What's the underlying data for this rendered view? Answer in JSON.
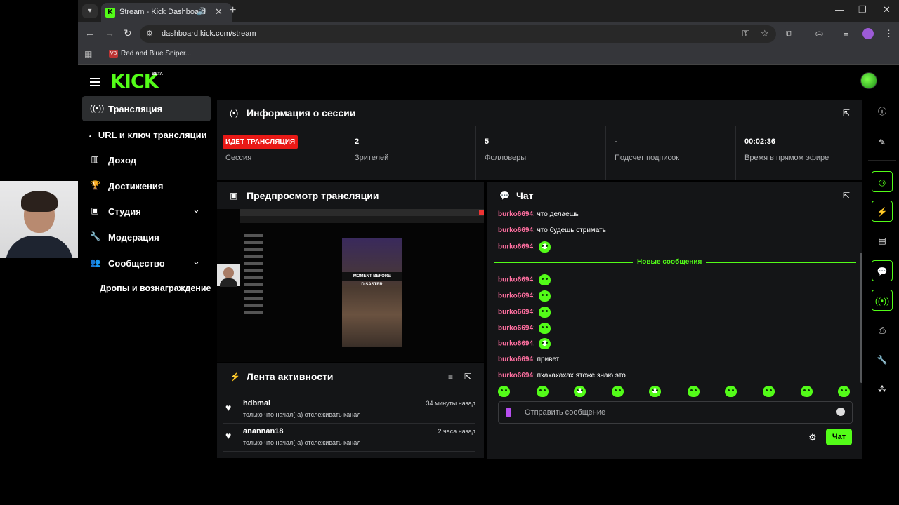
{
  "browser": {
    "tab_title": "Stream - Kick Dashboard",
    "url": "dashboard.kick.com/stream",
    "bookmark_label": "Red and Blue Sniper..."
  },
  "app": {
    "logo_text": "KICK",
    "beta_label": "BETA"
  },
  "sidebar": {
    "items": [
      {
        "label": "Трансляция",
        "icon": "broadcast-icon"
      },
      {
        "label": "URL и ключ трансляции",
        "icon": "dot-icon"
      },
      {
        "label": "Доход",
        "icon": "chart-icon"
      },
      {
        "label": "Достижения",
        "icon": "trophy-icon"
      },
      {
        "label": "Студия",
        "icon": "studio-icon"
      },
      {
        "label": "Модерация",
        "icon": "wrench-icon"
      },
      {
        "label": "Сообщество",
        "icon": "people-icon"
      },
      {
        "label": "Дропы и вознаграждение",
        "icon": "gift-icon"
      }
    ]
  },
  "session": {
    "title": "Информация о сессии",
    "live_badge": "ИДЕТ ТРАНСЛЯЦИЯ",
    "session_label": "Сессия",
    "stats": [
      {
        "value": "2",
        "label": "Зрителей"
      },
      {
        "value": "5",
        "label": "Фолловеры"
      },
      {
        "value": "-",
        "label": "Подсчет подписок"
      },
      {
        "value": "00:02:36",
        "label": "Время в прямом эфире"
      }
    ]
  },
  "preview": {
    "title": "Предпросмотр трансляции",
    "video_banner": "MOMENT BEFORE DISASTER"
  },
  "activity": {
    "title": "Лента активности",
    "rows": [
      {
        "name": "hdbmal",
        "desc": "только что начал(-а) отслеживать канал",
        "time": "34 минуты назад"
      },
      {
        "name": "anannan18",
        "desc": "только что начал(-а) отслеживать канал",
        "time": "2 часа назад"
      }
    ]
  },
  "chat": {
    "title": "Чат",
    "new_messages_label": "Новые сообщения",
    "messages": [
      {
        "user": "burko6694",
        "text": "что делаешь"
      },
      {
        "user": "burko6694",
        "text": "что будешь стримать"
      },
      {
        "user": "burko6694",
        "text": ""
      },
      {
        "user": "burko6694",
        "text": ""
      },
      {
        "user": "burko6694",
        "text": ""
      },
      {
        "user": "burko6694",
        "text": ""
      },
      {
        "user": "burko6694",
        "text": ""
      },
      {
        "user": "burko6694",
        "text": ""
      },
      {
        "user": "burko6694",
        "text": "привет"
      },
      {
        "user": "burko6694",
        "text": "пхахахахах ятоже знаю это"
      }
    ],
    "input_placeholder": "Отправить сообщение",
    "send_label": "Чат"
  },
  "colors": {
    "accent": "#53fc18",
    "live": "#e91916",
    "username": "#ff6fa0"
  }
}
